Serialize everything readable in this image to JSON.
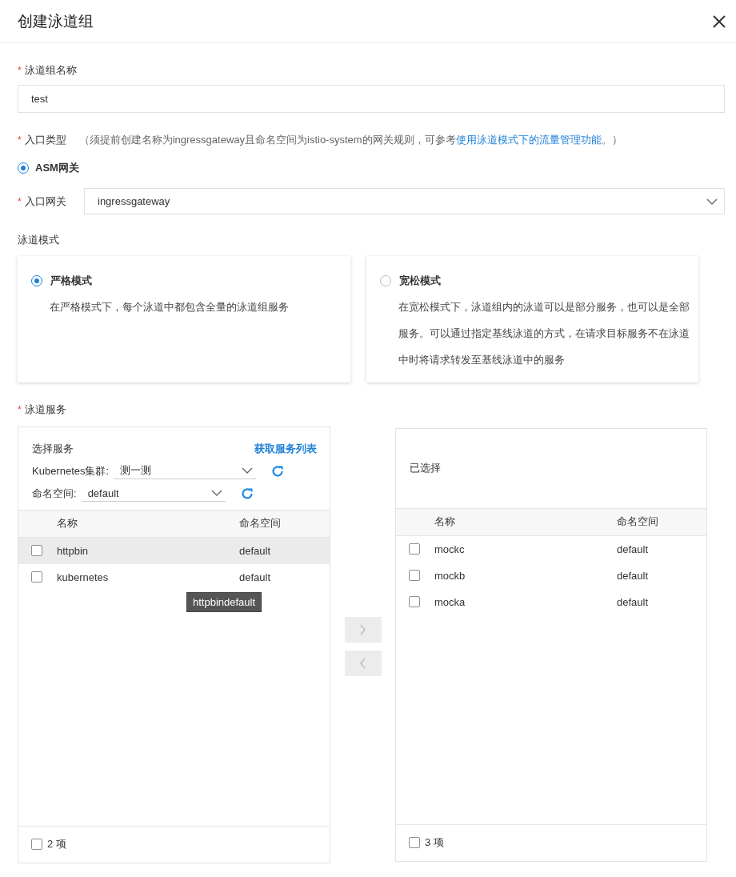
{
  "dialog": {
    "title": "创建泳道组"
  },
  "name_field": {
    "mark": "*",
    "label": "泳道组名称",
    "value": "test"
  },
  "entry_type": {
    "mark": "*",
    "label": "入口类型",
    "hint_before": "（须提前创建名称为ingressgateway且命名空间为istio-system的网关规则，可参考",
    "hint_link": "使用泳道模式下的流量管理功能",
    "hint_after": "。）",
    "options": [
      {
        "label": "ASM网关",
        "selected": true
      }
    ]
  },
  "gateway": {
    "mark": "*",
    "label": "入口网关",
    "value": "ingressgateway"
  },
  "mode": {
    "label": "泳道模式",
    "options": [
      {
        "title": "严格模式",
        "description": "在严格模式下，每个泳道中都包含全量的泳道组服务",
        "selected": true
      },
      {
        "title": "宽松模式",
        "description": "在宽松模式下，泳道组内的泳道可以是部分服务，也可以是全部服务。可以通过指定基线泳道的方式，在请求目标服务不在泳道中时将请求转发至基线泳道中的服务",
        "selected": false
      }
    ]
  },
  "services": {
    "mark": "*",
    "label": "泳道服务",
    "source": {
      "title": "选择服务",
      "action_link": "获取服务列表",
      "filters": [
        {
          "label": "Kubernetes集群:",
          "value": "测一测"
        },
        {
          "label": "命名空间:",
          "value": "default"
        }
      ],
      "columns": [
        "名称",
        "命名空间"
      ],
      "rows": [
        {
          "cells": [
            "httpbin",
            "default"
          ],
          "checked": false,
          "hovered": true
        },
        {
          "cells": [
            "kubernetes",
            "default"
          ],
          "checked": false,
          "hovered": false
        }
      ],
      "tooltip": "httpbindefault",
      "footer": {
        "checked": false,
        "count": "2 项"
      }
    },
    "transfer_buttons": [
      {
        "kind": "right",
        "disabled": true
      },
      {
        "kind": "left",
        "disabled": true
      }
    ],
    "target": {
      "title": "已选择",
      "columns": [
        "名称",
        "命名空间"
      ],
      "rows": [
        {
          "cells": [
            "mockc",
            "default"
          ],
          "checked": false,
          "hovered": false
        },
        {
          "cells": [
            "mockb",
            "default"
          ],
          "checked": false,
          "hovered": false
        },
        {
          "cells": [
            "mocka",
            "default"
          ],
          "checked": false,
          "hovered": false
        }
      ],
      "footer": {
        "checked": false,
        "count": "3 项"
      }
    }
  }
}
